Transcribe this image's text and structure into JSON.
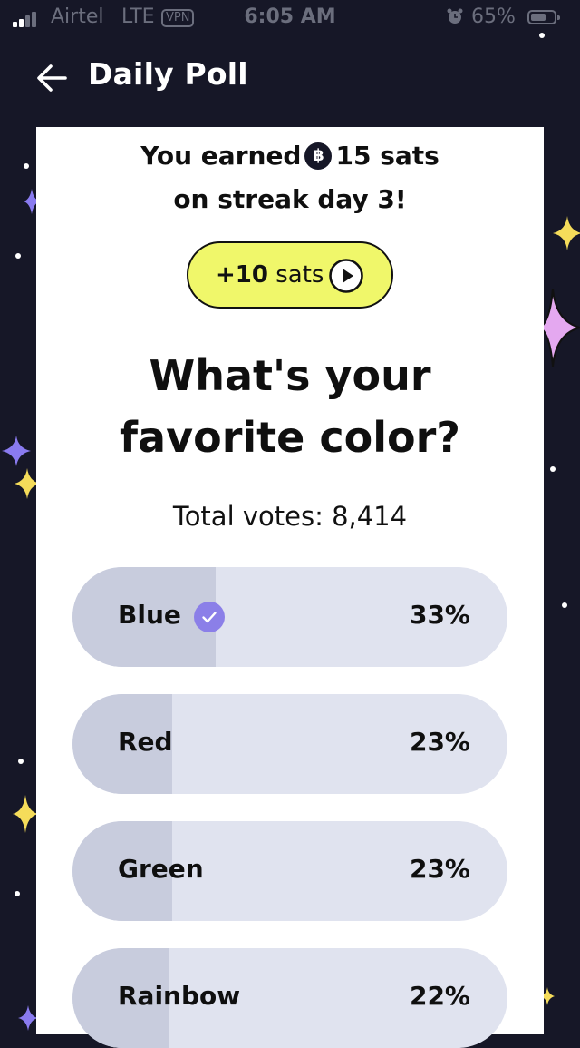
{
  "status_bar": {
    "carrier": "Airtel",
    "network": "LTE",
    "vpn": "VPN",
    "time": "6:05 AM",
    "battery_percent": "65%",
    "battery_level": 0.65,
    "icons": [
      "signal-icon",
      "alarm-icon",
      "battery-icon"
    ]
  },
  "header": {
    "title": "Daily Poll",
    "back_icon": "back-arrow-icon"
  },
  "reward": {
    "earned_prefix": "You earned",
    "coin_symbol": "฿",
    "earned_amount": "15 sats",
    "streak_text": "on streak day 3!",
    "bonus_amount": "+10",
    "bonus_unit": "sats",
    "bonus_icon": "play-icon"
  },
  "poll": {
    "question_line1": "What's your",
    "question_line2": "favorite color?",
    "total_votes": "Total votes: 8,414",
    "options": [
      {
        "label": "Blue",
        "percent": "33%",
        "fraction": 0.33,
        "selected": true
      },
      {
        "label": "Red",
        "percent": "23%",
        "fraction": 0.23,
        "selected": false
      },
      {
        "label": "Green",
        "percent": "23%",
        "fraction": 0.23,
        "selected": false
      },
      {
        "label": "Rainbow",
        "percent": "22%",
        "fraction": 0.22,
        "selected": false
      }
    ]
  },
  "colors": {
    "background": "#161727",
    "card": "#ffffff",
    "reward_button": "#f0f76a",
    "option_track": "#e0e3ef",
    "option_fill": "#c8ccdd",
    "check_badge": "#8b7fe8",
    "sparkle_yellow": "#f5dc5a",
    "sparkle_purple": "#8a7bf0",
    "sparkle_pink": "#e4a8f0"
  }
}
